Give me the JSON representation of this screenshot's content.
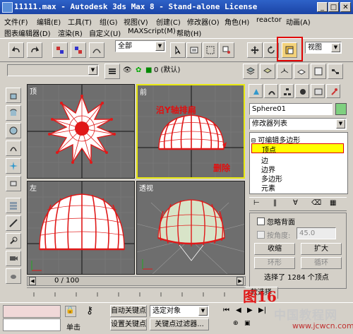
{
  "window": {
    "title": "11111.max - Autodesk 3ds Max 8 - Stand-alone License"
  },
  "menu1": [
    "文件(F)",
    "编辑(E)",
    "工具(T)",
    "组(G)",
    "视图(V)",
    "创建(C)",
    "修改器(O)",
    "角色(H)",
    "reactor",
    "动画(A)"
  ],
  "menu2": [
    "图表编辑器(D)",
    "渲染(R)",
    "自定义(U)",
    "MAXScript(M)",
    "帮助(H)"
  ],
  "toolbar": {
    "selection_filter": "全部",
    "view_dropdown": "视图"
  },
  "layer": {
    "label": "0 (默认)"
  },
  "viewports": {
    "top": "顶",
    "front": "前",
    "left": "左",
    "persp": "透视"
  },
  "annotations": {
    "front_note": "沿Y轴排扁",
    "delete_note": "删除",
    "figure_no": "图16"
  },
  "panel": {
    "object_name": "Sphere01",
    "modifier_list": "修改器列表",
    "stack_title": "可编辑多边形",
    "stack_items": [
      "顶点",
      "边",
      "边界",
      "多边形",
      "元素"
    ],
    "ignore_backface": "忽略背面",
    "by_angle": "按角度:",
    "angle_value": "45.0",
    "shrink": "收缩",
    "grow": "扩大",
    "ring": "环形",
    "loop": "循环",
    "selection_status": "选择了 1284 个顶点",
    "soft_selection": "软选择"
  },
  "timeline": {
    "frame": "0 / 100"
  },
  "status": {
    "auto_key": "自动关键点",
    "selected_object": "选定对象",
    "set_key": "设置关键点",
    "key_filter": "关键点过滤器...",
    "single_click": "单击"
  },
  "watermark": {
    "line1": "中国教程网",
    "line2": "www.jcwcn.com"
  },
  "colors": {
    "title_bar": "#2058c0",
    "viewport_bg": "#6e6e6e",
    "mesh_red": "#e01818",
    "selection_yellow": "#ffff00",
    "active_border": "#e8e810"
  }
}
